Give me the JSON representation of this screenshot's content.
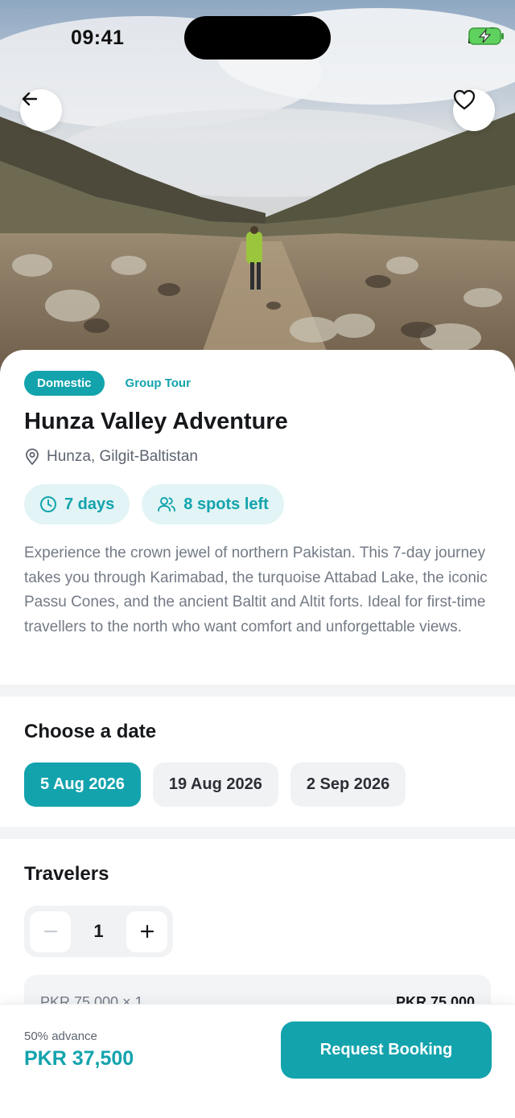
{
  "status_bar": {
    "time": "09:41"
  },
  "hero": {
    "back_icon": "arrow-left-icon",
    "favorite_icon": "heart-icon"
  },
  "tour": {
    "tag_primary": "Domestic",
    "tag_secondary": "Group Tour",
    "title": "Hunza Valley Adventure",
    "location": "Hunza, Gilgit-Baltistan",
    "duration": "7 days",
    "spots": "8 spots left",
    "description": "Experience the crown jewel of northern Pakistan. This 7-day journey takes you through Karimabad, the turquoise Attabad Lake, the iconic Passu Cones, and the ancient Baltit and Altit forts. Ideal for first-time travellers to the north who want comfort and unforgettable views."
  },
  "dates": {
    "title": "Choose a date",
    "options": [
      "5 Aug 2026",
      "19 Aug 2026",
      "2 Sep 2026"
    ],
    "selected": "5 Aug 2026"
  },
  "travelers": {
    "title": "Travelers",
    "count": "1",
    "summary_label": "PKR 75,000 × 1",
    "summary_amount": "PKR 75,000"
  },
  "footer": {
    "advance_label": "50% advance",
    "advance_amount": "PKR 37,500",
    "cta": "Request Booking"
  },
  "colors": {
    "accent": "#13a3ad",
    "accent_light": "#e2f4f5"
  }
}
